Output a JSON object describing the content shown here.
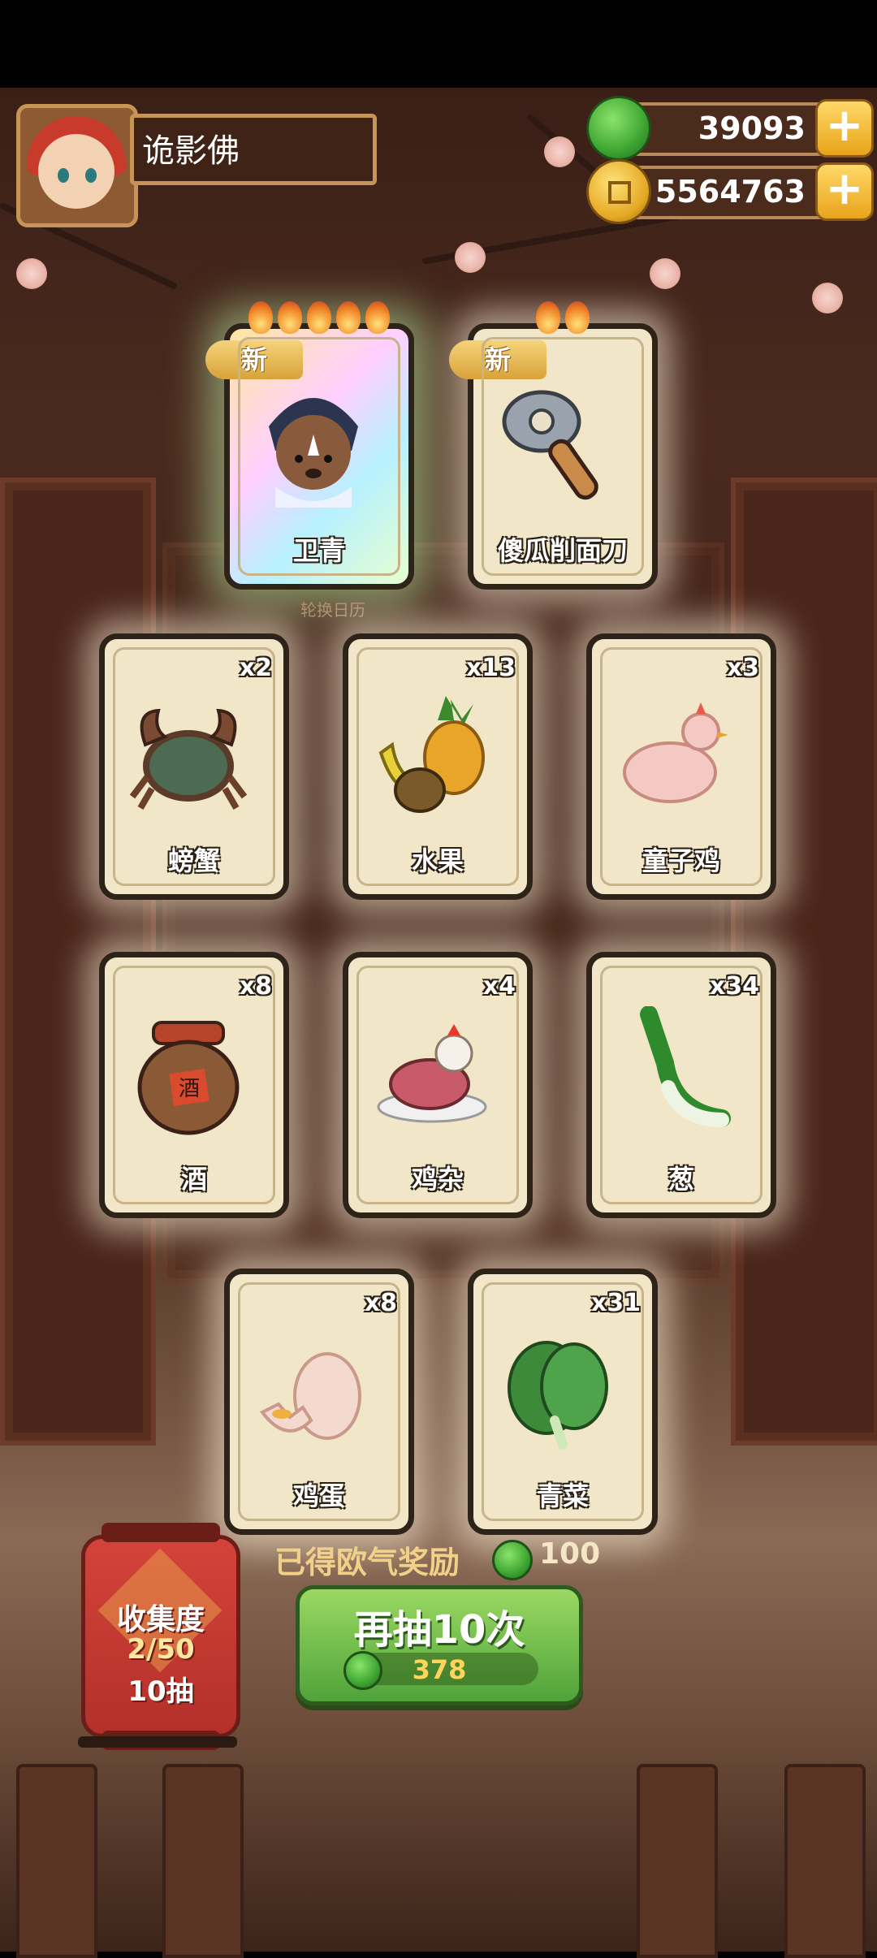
{
  "player": {
    "name": "诡影佛"
  },
  "resources": {
    "jade": "39093",
    "coins": "5564763"
  },
  "featured": [
    {
      "name": "卫青",
      "tag": "新",
      "flames": 5,
      "style": "rainbow"
    },
    {
      "name": "傻瓜削面刀",
      "tag": "新",
      "flames": 2,
      "style": "normal"
    }
  ],
  "caption": "轮换日历",
  "items": [
    {
      "name": "螃蟹",
      "count": "x2",
      "icon": "crab-icon"
    },
    {
      "name": "水果",
      "count": "x13",
      "icon": "fruit-icon"
    },
    {
      "name": "童子鸡",
      "count": "x3",
      "icon": "chicken-icon"
    },
    {
      "name": "酒",
      "count": "x8",
      "icon": "wine-jar-icon"
    },
    {
      "name": "鸡杂",
      "count": "x4",
      "icon": "chicken-giblets-icon"
    },
    {
      "name": "葱",
      "count": "x34",
      "icon": "scallion-icon"
    },
    {
      "name": "鸡蛋",
      "count": "x8",
      "icon": "egg-icon"
    },
    {
      "name": "青菜",
      "count": "x31",
      "icon": "greens-icon"
    }
  ],
  "reward": {
    "label": "已得欧气奖励",
    "value": "100"
  },
  "collection": {
    "title": "收集度",
    "progress": "2/50",
    "draws": "10抽"
  },
  "draw_button": {
    "label": "再抽10次",
    "cost": "378"
  },
  "colors": {
    "accent_green": "#4fa33a",
    "gold": "#e8a41a",
    "lantern_red": "#c83a2b"
  }
}
